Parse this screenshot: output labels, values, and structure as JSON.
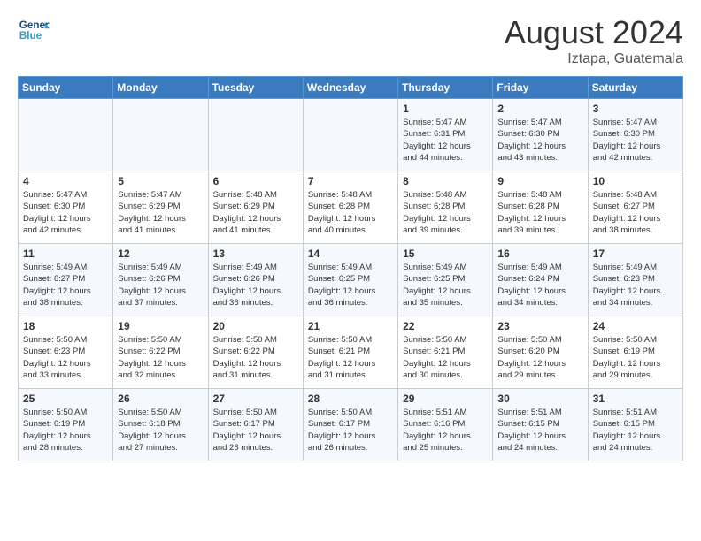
{
  "header": {
    "logo_line1": "General",
    "logo_line2": "Blue",
    "main_title": "August 2024",
    "subtitle": "Iztapa, Guatemala"
  },
  "days_of_week": [
    "Sunday",
    "Monday",
    "Tuesday",
    "Wednesday",
    "Thursday",
    "Friday",
    "Saturday"
  ],
  "weeks": [
    [
      {
        "day": "",
        "info": ""
      },
      {
        "day": "",
        "info": ""
      },
      {
        "day": "",
        "info": ""
      },
      {
        "day": "",
        "info": ""
      },
      {
        "day": "1",
        "info": "Sunrise: 5:47 AM\nSunset: 6:31 PM\nDaylight: 12 hours\nand 44 minutes."
      },
      {
        "day": "2",
        "info": "Sunrise: 5:47 AM\nSunset: 6:30 PM\nDaylight: 12 hours\nand 43 minutes."
      },
      {
        "day": "3",
        "info": "Sunrise: 5:47 AM\nSunset: 6:30 PM\nDaylight: 12 hours\nand 42 minutes."
      }
    ],
    [
      {
        "day": "4",
        "info": "Sunrise: 5:47 AM\nSunset: 6:30 PM\nDaylight: 12 hours\nand 42 minutes."
      },
      {
        "day": "5",
        "info": "Sunrise: 5:47 AM\nSunset: 6:29 PM\nDaylight: 12 hours\nand 41 minutes."
      },
      {
        "day": "6",
        "info": "Sunrise: 5:48 AM\nSunset: 6:29 PM\nDaylight: 12 hours\nand 41 minutes."
      },
      {
        "day": "7",
        "info": "Sunrise: 5:48 AM\nSunset: 6:28 PM\nDaylight: 12 hours\nand 40 minutes."
      },
      {
        "day": "8",
        "info": "Sunrise: 5:48 AM\nSunset: 6:28 PM\nDaylight: 12 hours\nand 39 minutes."
      },
      {
        "day": "9",
        "info": "Sunrise: 5:48 AM\nSunset: 6:28 PM\nDaylight: 12 hours\nand 39 minutes."
      },
      {
        "day": "10",
        "info": "Sunrise: 5:48 AM\nSunset: 6:27 PM\nDaylight: 12 hours\nand 38 minutes."
      }
    ],
    [
      {
        "day": "11",
        "info": "Sunrise: 5:49 AM\nSunset: 6:27 PM\nDaylight: 12 hours\nand 38 minutes."
      },
      {
        "day": "12",
        "info": "Sunrise: 5:49 AM\nSunset: 6:26 PM\nDaylight: 12 hours\nand 37 minutes."
      },
      {
        "day": "13",
        "info": "Sunrise: 5:49 AM\nSunset: 6:26 PM\nDaylight: 12 hours\nand 36 minutes."
      },
      {
        "day": "14",
        "info": "Sunrise: 5:49 AM\nSunset: 6:25 PM\nDaylight: 12 hours\nand 36 minutes."
      },
      {
        "day": "15",
        "info": "Sunrise: 5:49 AM\nSunset: 6:25 PM\nDaylight: 12 hours\nand 35 minutes."
      },
      {
        "day": "16",
        "info": "Sunrise: 5:49 AM\nSunset: 6:24 PM\nDaylight: 12 hours\nand 34 minutes."
      },
      {
        "day": "17",
        "info": "Sunrise: 5:49 AM\nSunset: 6:23 PM\nDaylight: 12 hours\nand 34 minutes."
      }
    ],
    [
      {
        "day": "18",
        "info": "Sunrise: 5:50 AM\nSunset: 6:23 PM\nDaylight: 12 hours\nand 33 minutes."
      },
      {
        "day": "19",
        "info": "Sunrise: 5:50 AM\nSunset: 6:22 PM\nDaylight: 12 hours\nand 32 minutes."
      },
      {
        "day": "20",
        "info": "Sunrise: 5:50 AM\nSunset: 6:22 PM\nDaylight: 12 hours\nand 31 minutes."
      },
      {
        "day": "21",
        "info": "Sunrise: 5:50 AM\nSunset: 6:21 PM\nDaylight: 12 hours\nand 31 minutes."
      },
      {
        "day": "22",
        "info": "Sunrise: 5:50 AM\nSunset: 6:21 PM\nDaylight: 12 hours\nand 30 minutes."
      },
      {
        "day": "23",
        "info": "Sunrise: 5:50 AM\nSunset: 6:20 PM\nDaylight: 12 hours\nand 29 minutes."
      },
      {
        "day": "24",
        "info": "Sunrise: 5:50 AM\nSunset: 6:19 PM\nDaylight: 12 hours\nand 29 minutes."
      }
    ],
    [
      {
        "day": "25",
        "info": "Sunrise: 5:50 AM\nSunset: 6:19 PM\nDaylight: 12 hours\nand 28 minutes."
      },
      {
        "day": "26",
        "info": "Sunrise: 5:50 AM\nSunset: 6:18 PM\nDaylight: 12 hours\nand 27 minutes."
      },
      {
        "day": "27",
        "info": "Sunrise: 5:50 AM\nSunset: 6:17 PM\nDaylight: 12 hours\nand 26 minutes."
      },
      {
        "day": "28",
        "info": "Sunrise: 5:50 AM\nSunset: 6:17 PM\nDaylight: 12 hours\nand 26 minutes."
      },
      {
        "day": "29",
        "info": "Sunrise: 5:51 AM\nSunset: 6:16 PM\nDaylight: 12 hours\nand 25 minutes."
      },
      {
        "day": "30",
        "info": "Sunrise: 5:51 AM\nSunset: 6:15 PM\nDaylight: 12 hours\nand 24 minutes."
      },
      {
        "day": "31",
        "info": "Sunrise: 5:51 AM\nSunset: 6:15 PM\nDaylight: 12 hours\nand 24 minutes."
      }
    ]
  ]
}
